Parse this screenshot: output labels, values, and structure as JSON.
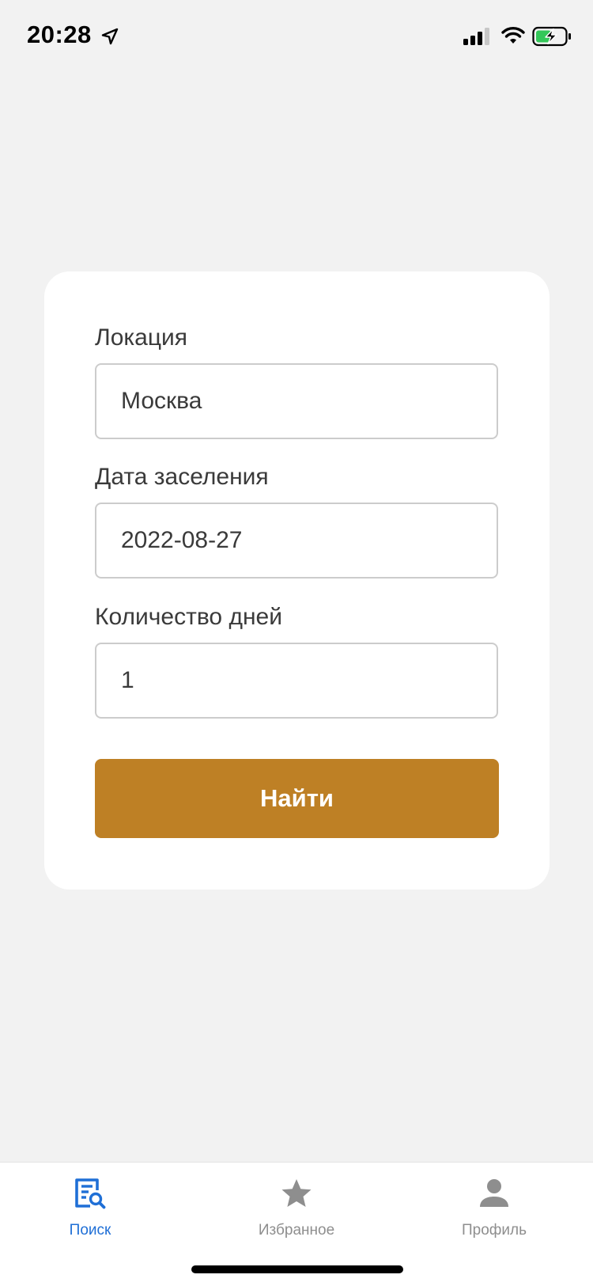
{
  "status_bar": {
    "time": "20:28",
    "icons": [
      "location-arrow-icon",
      "signal-icon",
      "wifi-icon",
      "battery-charging-icon"
    ]
  },
  "search_form": {
    "location": {
      "label": "Локация",
      "value": "Москва"
    },
    "check_in_date": {
      "label": "Дата заселения",
      "value": "2022-08-27"
    },
    "days_count": {
      "label": "Количество дней",
      "value": "1"
    },
    "submit_label": "Найти"
  },
  "tab_bar": {
    "tabs": [
      {
        "label": "Поиск",
        "icon": "search-document-icon",
        "active": true
      },
      {
        "label": "Избранное",
        "icon": "star-icon",
        "active": false
      },
      {
        "label": "Профиль",
        "icon": "person-icon",
        "active": false
      }
    ]
  },
  "colors": {
    "background": "#f2f2f2",
    "card": "#ffffff",
    "accent_button": "#be8025",
    "active_tab": "#1f6fd6",
    "inactive_tab": "#8e8e8e",
    "battery_green": "#34c759"
  }
}
